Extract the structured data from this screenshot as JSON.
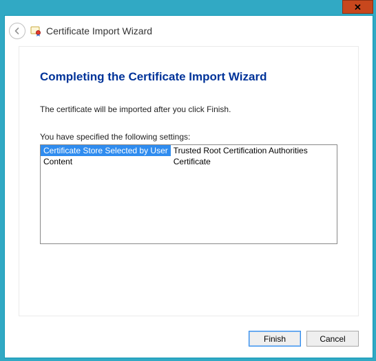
{
  "window": {
    "close_glyph": "✕"
  },
  "header": {
    "title": "Certificate Import Wizard"
  },
  "page": {
    "title": "Completing the Certificate Import Wizard",
    "description": "The certificate will be imported after you click Finish.",
    "settings_label": "You have specified the following settings:",
    "settings": [
      {
        "key": "Certificate Store Selected by User",
        "value": "Trusted Root Certification Authorities",
        "selected": true
      },
      {
        "key": "Content",
        "value": "Certificate",
        "selected": false
      }
    ]
  },
  "footer": {
    "finish_label": "Finish",
    "cancel_label": "Cancel"
  }
}
